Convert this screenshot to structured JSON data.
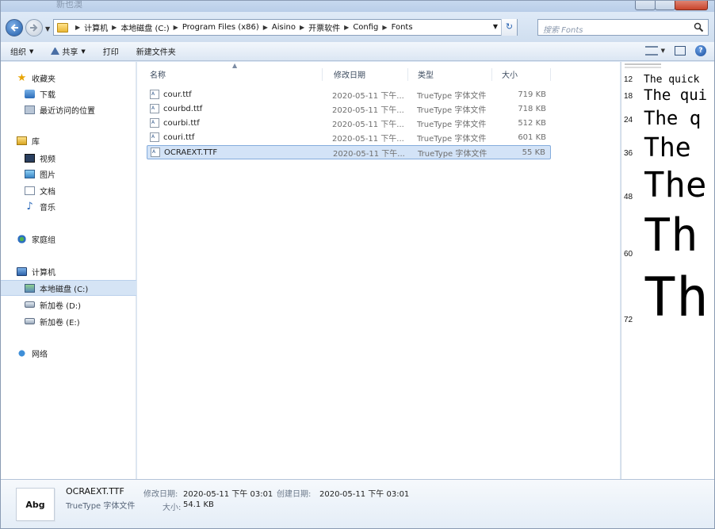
{
  "window": {
    "title": "新也澳"
  },
  "address": {
    "crumbs": [
      "计算机",
      "本地磁盘 (C:)",
      "Program Files (x86)",
      "Aisino",
      "开票软件",
      "Config",
      "Fonts"
    ]
  },
  "search": {
    "placeholder": "搜索 Fonts"
  },
  "toolbar": {
    "organize": "组织",
    "share": "共享",
    "print": "打印",
    "new_folder": "新建文件夹"
  },
  "sidebar": {
    "favorites": "收藏夹",
    "downloads": "下载",
    "recent": "最近访问的位置",
    "libraries": "库",
    "videos": "视频",
    "pictures": "图片",
    "documents": "文档",
    "music": "音乐",
    "homegroup": "家庭组",
    "computer": "计算机",
    "drive_c": "本地磁盘 (C:)",
    "drive_d": "新加卷 (D:)",
    "drive_e": "新加卷 (E:)",
    "network": "网络"
  },
  "columns": {
    "name": "名称",
    "date": "修改日期",
    "type": "类型",
    "size": "大小"
  },
  "files": [
    {
      "name": "cour.ttf",
      "date": "2020-05-11 下午...",
      "type": "TrueType 字体文件",
      "size": "719 KB"
    },
    {
      "name": "courbd.ttf",
      "date": "2020-05-11 下午...",
      "type": "TrueType 字体文件",
      "size": "718 KB"
    },
    {
      "name": "courbi.ttf",
      "date": "2020-05-11 下午...",
      "type": "TrueType 字体文件",
      "size": "512 KB"
    },
    {
      "name": "couri.ttf",
      "date": "2020-05-11 下午...",
      "type": "TrueType 字体文件",
      "size": "601 KB"
    },
    {
      "name": "OCRAEXT.TTF",
      "date": "2020-05-11 下午...",
      "type": "TrueType 字体文件",
      "size": "55 KB"
    }
  ],
  "preview": {
    "rows": [
      {
        "size": "12",
        "text": "The quick"
      },
      {
        "size": "18",
        "text": "The qui"
      },
      {
        "size": "24",
        "text": "The q"
      },
      {
        "size": "36",
        "text": "The"
      },
      {
        "size": "48",
        "text": "The"
      },
      {
        "size": "60",
        "text": "Th"
      },
      {
        "size": "72",
        "text": "Th"
      }
    ]
  },
  "details": {
    "thumb_text": "Abg",
    "name": "OCRAEXT.TTF",
    "type": "TrueType 字体文件",
    "modified_label": "修改日期:",
    "modified_value": "2020-05-11 下午 03:01",
    "created_label": "创建日期:",
    "created_value": "2020-05-11 下午 03:01",
    "size_label": "大小:",
    "size_value": "54.1 KB"
  },
  "colors": {
    "selection": "#d3e3f7",
    "accent": "#2b66b3"
  }
}
